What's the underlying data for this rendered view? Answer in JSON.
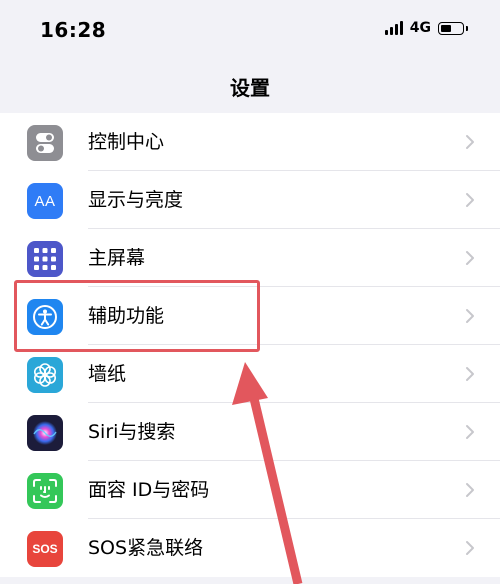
{
  "status_bar": {
    "time": "16:28",
    "network": "4G",
    "battery_level": 0.45
  },
  "nav": {
    "title": "设置"
  },
  "settings_items": [
    {
      "label": "控制中心",
      "icon": "control-center-icon",
      "icon_color": "#8e8e93"
    },
    {
      "label": "显示与亮度",
      "icon": "display-brightness-icon",
      "icon_text": "AA",
      "icon_color": "#2f7cf6"
    },
    {
      "label": "主屏幕",
      "icon": "home-screen-icon",
      "icon_color": "#4d57c9"
    },
    {
      "label": "辅助功能",
      "icon": "accessibility-icon",
      "icon_color": "#1f86f0",
      "highlighted": true
    },
    {
      "label": "墙纸",
      "icon": "wallpaper-icon",
      "icon_color": "#2aa7d8"
    },
    {
      "label": "Siri与搜索",
      "icon": "siri-icon",
      "icon_color": "#1c1c3a"
    },
    {
      "label": "面容 ID与密码",
      "icon": "face-id-icon",
      "icon_color": "#34c759"
    },
    {
      "label": "SOS紧急联络",
      "icon": "sos-icon",
      "icon_text": "SOS",
      "icon_color": "#e8453c"
    }
  ],
  "annotation": {
    "highlight_color": "#e2575d",
    "arrow_color": "#e2575d"
  }
}
